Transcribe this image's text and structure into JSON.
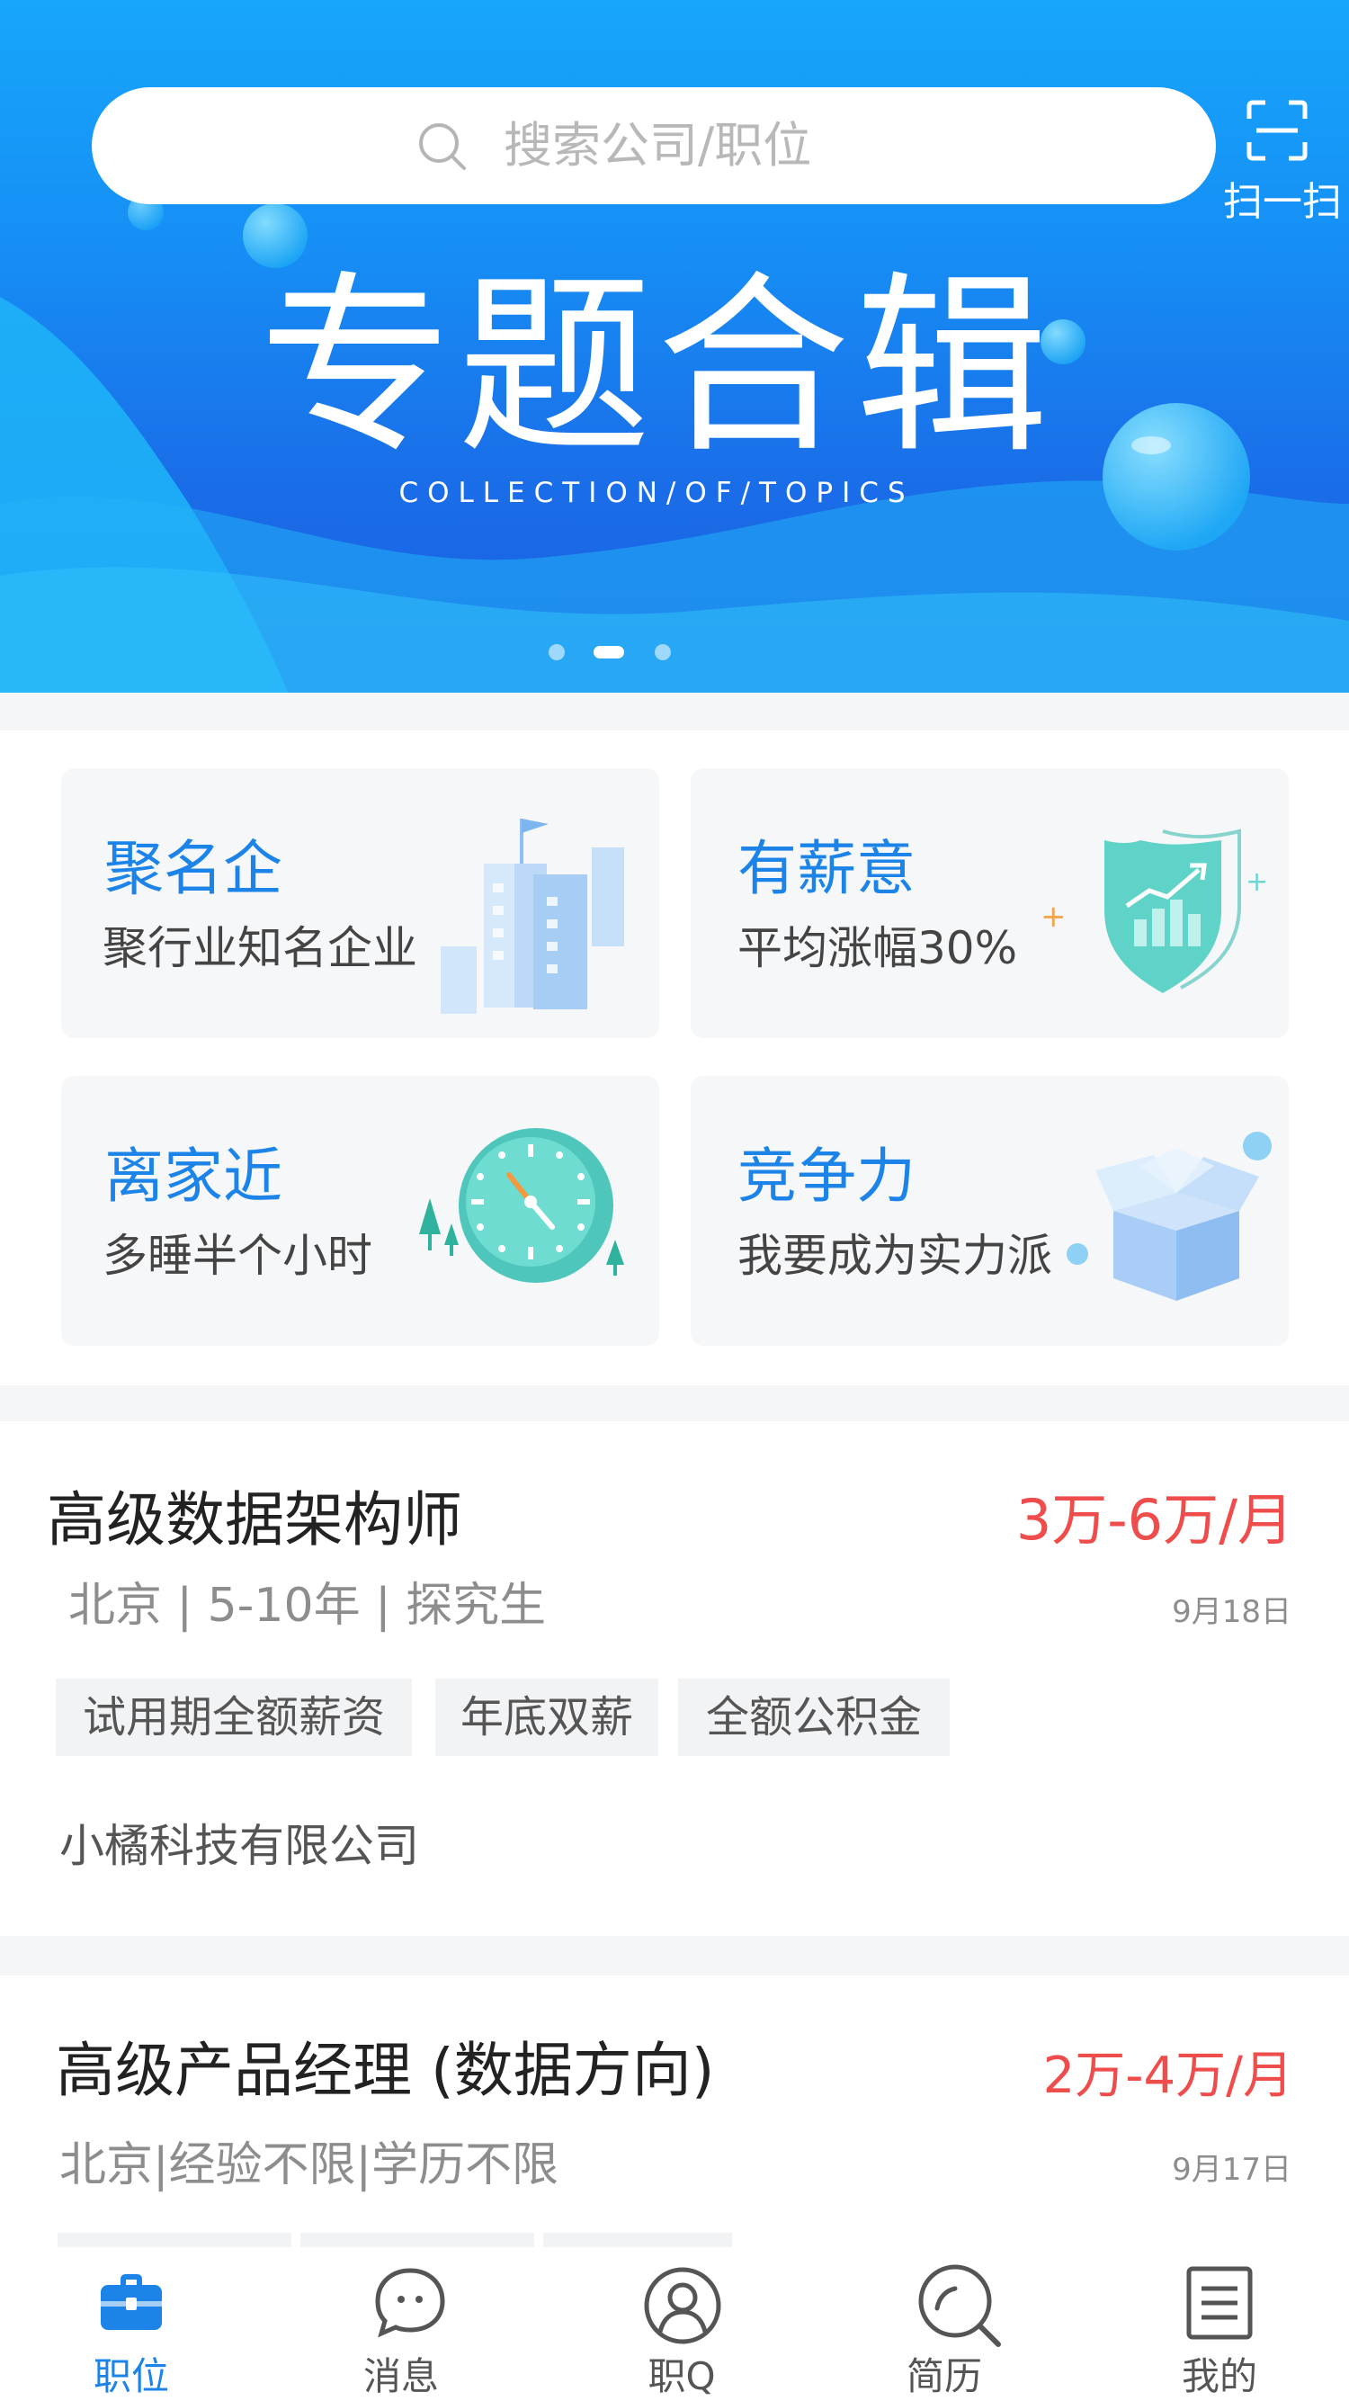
{
  "search": {
    "placeholder": "搜索公司/职位",
    "icon": "search-icon"
  },
  "scan": {
    "label": "扫一扫",
    "icon": "scan-icon"
  },
  "banner": {
    "title": "专题合辑",
    "subtitle": "COLLECTION/OF/TOPICS",
    "pages": 3,
    "active_page": 2
  },
  "features": [
    {
      "title": "聚名企",
      "subtitle": "聚行业知名企业",
      "icon": "buildings-icon"
    },
    {
      "title": "有薪意",
      "subtitle": "平均涨幅30%",
      "icon": "shield-growth-icon"
    },
    {
      "title": "离家近",
      "subtitle": "多睡半个小时",
      "icon": "clock-icon"
    },
    {
      "title": "竞争力",
      "subtitle": "我要成为实力派",
      "icon": "box-icon"
    }
  ],
  "jobs": [
    {
      "title": "高级数据架构师",
      "salary": "3万-6万/月",
      "meta": "北京 | 5-10年 | 探究生",
      "date": "9月18日",
      "tags": [
        "试用期全额薪资",
        "年底双薪",
        "全额公积金"
      ],
      "company": "小橘科技有限公司"
    },
    {
      "title": "高级产品经理 (数据方向)",
      "salary": "2万-4万/月",
      "meta": "北京|经验不限|学历不限",
      "date": "9月17日"
    }
  ],
  "tabs": [
    {
      "label": "职位",
      "icon": "briefcase-icon",
      "active": true
    },
    {
      "label": "消息",
      "icon": "chat-icon",
      "active": false
    },
    {
      "label": "职Q",
      "icon": "user-icon",
      "active": false
    },
    {
      "label": "简历",
      "icon": "search-resume-icon",
      "active": false
    },
    {
      "label": "我的",
      "icon": "document-icon",
      "active": false
    }
  ],
  "colors": {
    "accent": "#1c84e8",
    "salary": "#ef4c4c",
    "banner_top": "#17a6fb",
    "banner_bottom": "#1b5fe0"
  }
}
